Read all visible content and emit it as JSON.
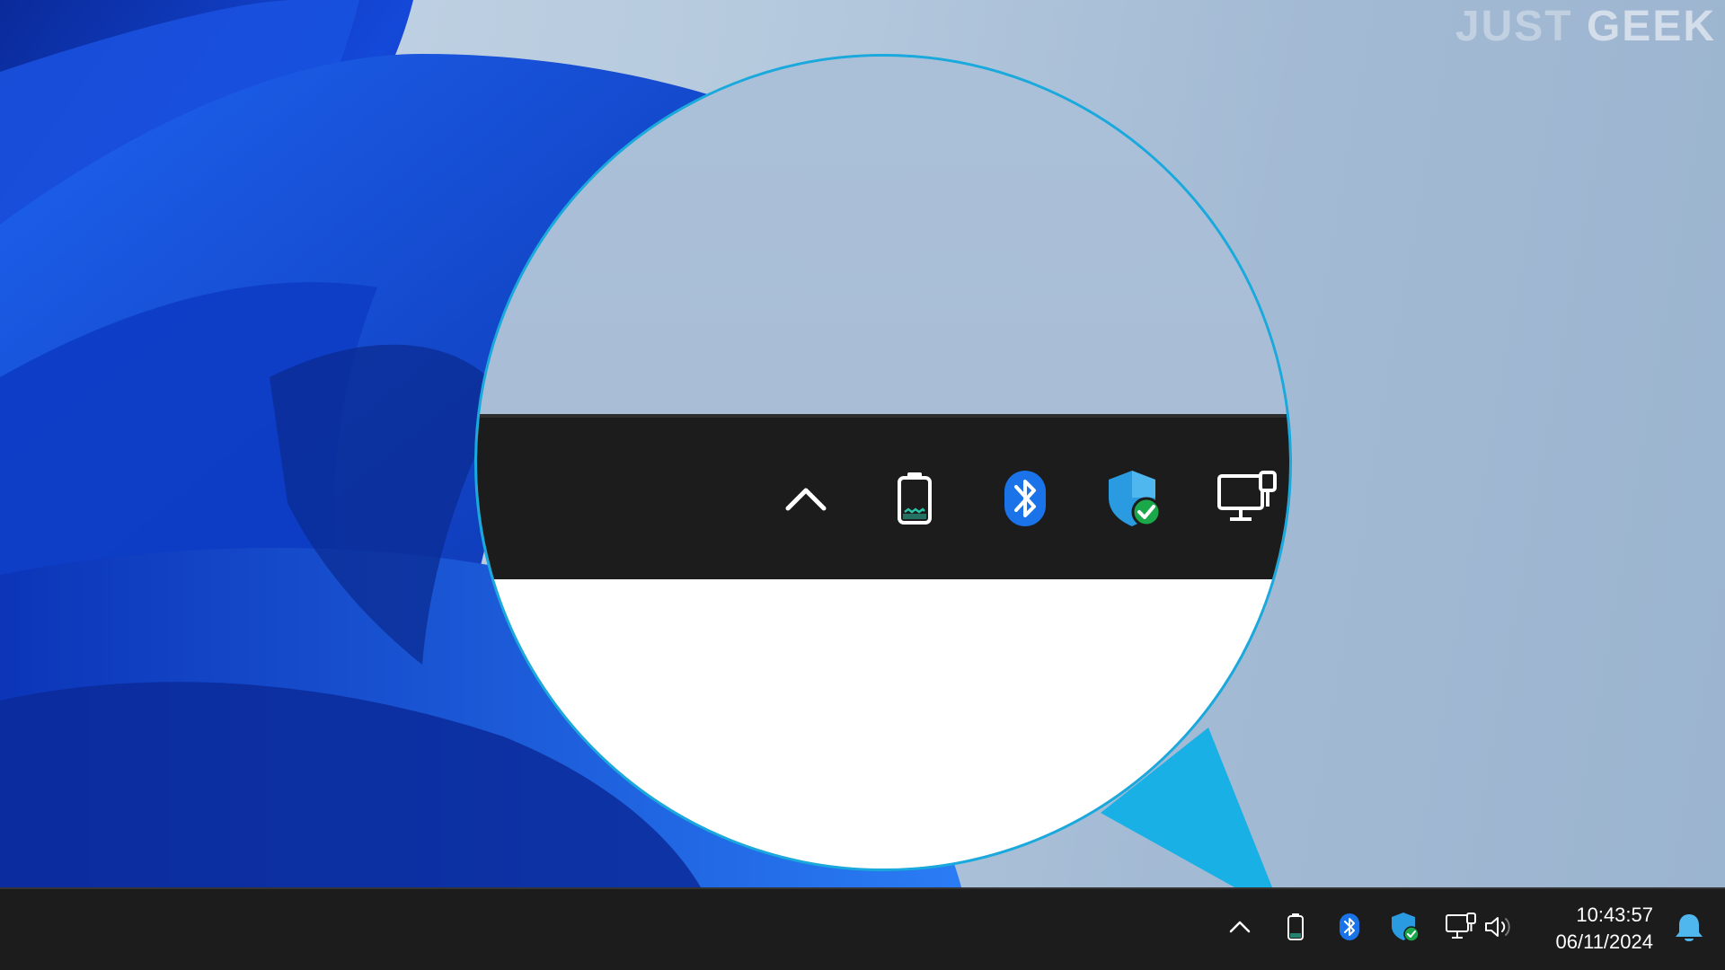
{
  "watermark": {
    "part1": "JUST",
    "part2": "GEEK"
  },
  "colors": {
    "accent": "#19a9dc",
    "taskbar": "#1c1c1c",
    "bluetooth": "#1a73e8",
    "shield": "#2a9be0",
    "check": "#1aa84a"
  },
  "magnifier": {
    "icons": [
      "chevron-up-icon",
      "battery-icon",
      "bluetooth-icon",
      "windows-security-icon",
      "network-icon"
    ]
  },
  "tray": {
    "icons": [
      "chevron-up-icon",
      "battery-icon",
      "bluetooth-icon",
      "windows-security-icon",
      "network-icon",
      "volume-icon"
    ],
    "time": "10:43:57",
    "date": "06/11/2024",
    "notification_icon": "bell-icon"
  }
}
